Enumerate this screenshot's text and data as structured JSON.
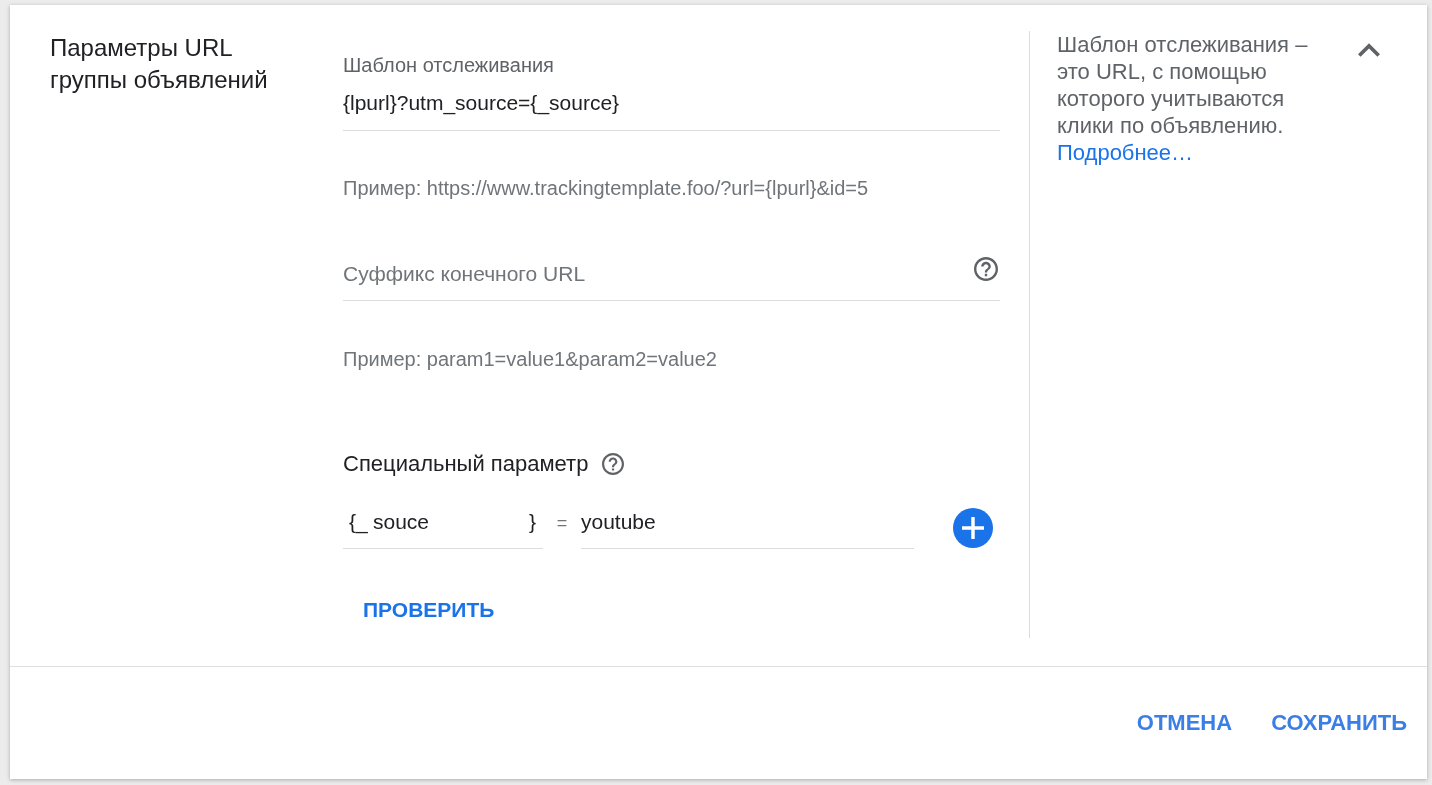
{
  "section": {
    "title": "Параметры URL группы объявлений",
    "expanded": true
  },
  "tracking_template": {
    "label": "Шаблон отслеживания",
    "value": "{lpurl}?utm_source={_source}",
    "hint": "Пример: https://www.trackingtemplate.foo/?url={lpurl}&id=5"
  },
  "final_url_suffix": {
    "placeholder": "Суффикс конечного URL",
    "hint": "Пример: param1=value1&param2=value2"
  },
  "custom_parameter": {
    "label": "Специальный параметр",
    "key_prefix": "{_",
    "key": "souce",
    "key_suffix": "}",
    "equals": "=",
    "value": "youtube"
  },
  "check_button": "ПРОВЕРИТЬ",
  "help": {
    "text": "Шаблон отслеживания – это URL, с помощью которого учитываются клики по объявлению.",
    "link": "Подробнее…"
  },
  "footer": {
    "buttons": [
      "ОТМЕНА",
      "СОХРАНИТЬ"
    ]
  }
}
